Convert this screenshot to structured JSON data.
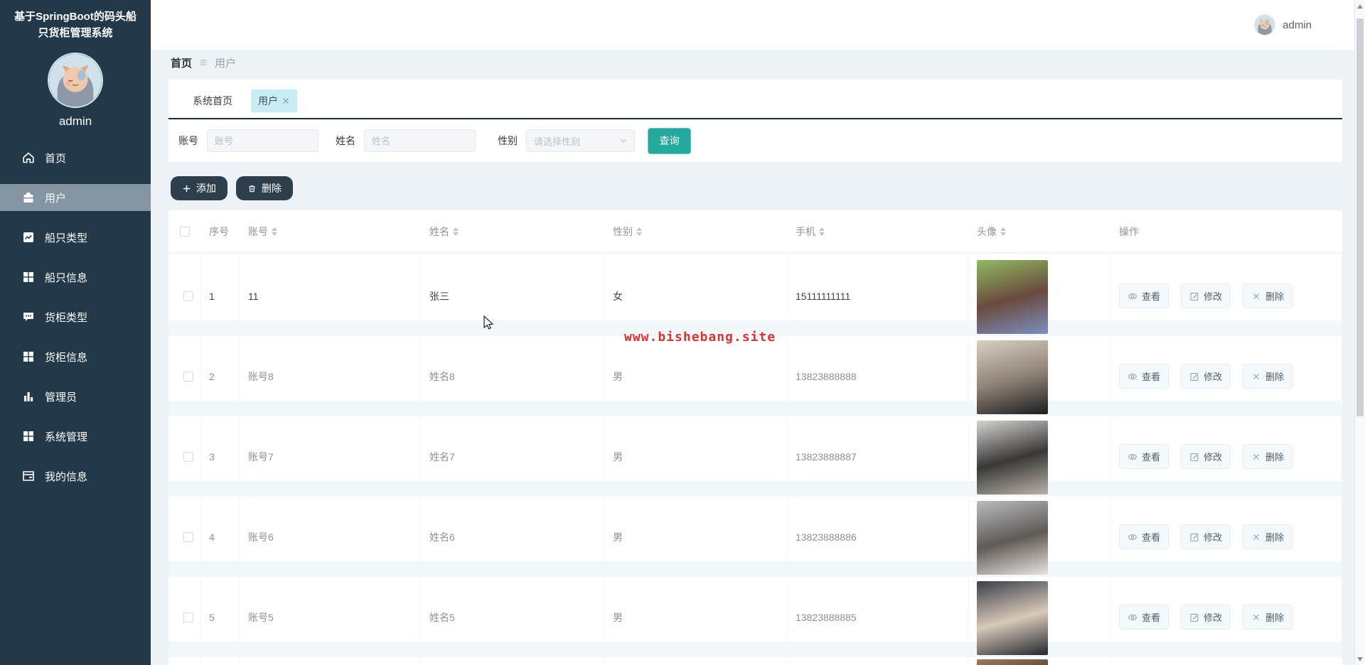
{
  "app": {
    "title": "基于SpringBoot的码头船只货柜管理系统"
  },
  "sidebar": {
    "username": "admin",
    "avatar": "cat-avatar-icon",
    "items": [
      {
        "label": "首页",
        "icon": "home-icon",
        "active": false
      },
      {
        "label": "用户",
        "icon": "briefcase-icon",
        "active": true
      },
      {
        "label": "船只类型",
        "icon": "chart-line-icon",
        "active": false
      },
      {
        "label": "船只信息",
        "icon": "grid-icon",
        "active": false
      },
      {
        "label": "货柜类型",
        "icon": "comment-icon",
        "active": false
      },
      {
        "label": "货柜信息",
        "icon": "grid-icon",
        "active": false
      },
      {
        "label": "管理员",
        "icon": "bar-chart-icon",
        "active": false
      },
      {
        "label": "系统管理",
        "icon": "grid-icon",
        "active": false
      },
      {
        "label": "我的信息",
        "icon": "notebook-icon",
        "active": false
      }
    ]
  },
  "topbar": {
    "username": "admin",
    "avatar": "cat-avatar-icon"
  },
  "breadcrumb": {
    "root": "首页",
    "separator": "hamburger-icon",
    "current": "用户"
  },
  "tabs": [
    {
      "label": "系统首页",
      "active": false,
      "closable": false
    },
    {
      "label": "用户",
      "active": true,
      "closable": true
    }
  ],
  "search": {
    "account": {
      "label": "账号",
      "placeholder": "账号"
    },
    "name": {
      "label": "姓名",
      "placeholder": "姓名"
    },
    "gender": {
      "label": "性别",
      "placeholder": "请选择性别",
      "chevron": "chevron-down-icon"
    },
    "submit": {
      "label": "查询"
    }
  },
  "toolbar": {
    "add": {
      "label": "添加",
      "icon": "plus-icon"
    },
    "delete": {
      "label": "删除",
      "icon": "trash-icon"
    }
  },
  "table": {
    "columns": [
      {
        "label": "序号",
        "sortable": false
      },
      {
        "label": "账号",
        "sortable": true
      },
      {
        "label": "姓名",
        "sortable": true
      },
      {
        "label": "性别",
        "sortable": true
      },
      {
        "label": "手机",
        "sortable": true
      },
      {
        "label": "头像",
        "sortable": true
      },
      {
        "label": "操作",
        "sortable": false
      }
    ],
    "actions": [
      {
        "label": "查看",
        "icon": "eye-icon"
      },
      {
        "label": "修改",
        "icon": "edit-icon"
      },
      {
        "label": "删除",
        "icon": "x-icon"
      }
    ],
    "rows": [
      {
        "index": "1",
        "account": "11",
        "name": "张三",
        "gender": "女",
        "phone": "15111111111",
        "emphasis": true,
        "avatar": {
          "desc": "long-haired woman, green outdoor background",
          "colors": [
            "#8fba62",
            "#6b4a3e",
            "#7b8fc0"
          ]
        }
      },
      {
        "index": "2",
        "account": "账号8",
        "name": "姓名8",
        "gender": "男",
        "phone": "13823888888",
        "emphasis": false,
        "avatar": {
          "desc": "man in black turtleneck, beige wall",
          "colors": [
            "#d8cfc2",
            "#8f8376",
            "#1d1d1f"
          ]
        }
      },
      {
        "index": "3",
        "account": "账号7",
        "name": "姓名7",
        "gender": "男",
        "phone": "13823888887",
        "emphasis": false,
        "avatar": {
          "desc": "young man with black hair looking up",
          "colors": [
            "#d6d3cf",
            "#3a3836",
            "#b9b2a8"
          ]
        }
      },
      {
        "index": "4",
        "account": "账号6",
        "name": "姓名6",
        "gender": "男",
        "phone": "13823888886",
        "emphasis": false,
        "avatar": {
          "desc": "woman in light top, gray background",
          "colors": [
            "#b9bcbe",
            "#5f5a56",
            "#e8e4df"
          ]
        }
      },
      {
        "index": "5",
        "account": "账号5",
        "name": "姓名5",
        "gender": "男",
        "phone": "13823888885",
        "emphasis": false,
        "avatar": {
          "desc": "anime character with forehead headband",
          "colors": [
            "#3a3f4a",
            "#d8c9b8",
            "#23262d"
          ]
        }
      }
    ],
    "partial_row": {
      "avatar": {
        "desc": "partially visible next avatar",
        "colors": [
          "#9b7b60",
          "#7c5e49",
          "#5e453a"
        ]
      }
    }
  },
  "watermark": {
    "text": "www.bishebang.site",
    "color": "#e03131"
  },
  "colors": {
    "sidebar_bg": "#22394a",
    "sidebar_active": "#8494a0",
    "accent_teal": "#21aa9d",
    "dark_button": "#2d3e4d",
    "tab_active_bg": "#c7edf5",
    "page_bg": "#edf2f6"
  }
}
